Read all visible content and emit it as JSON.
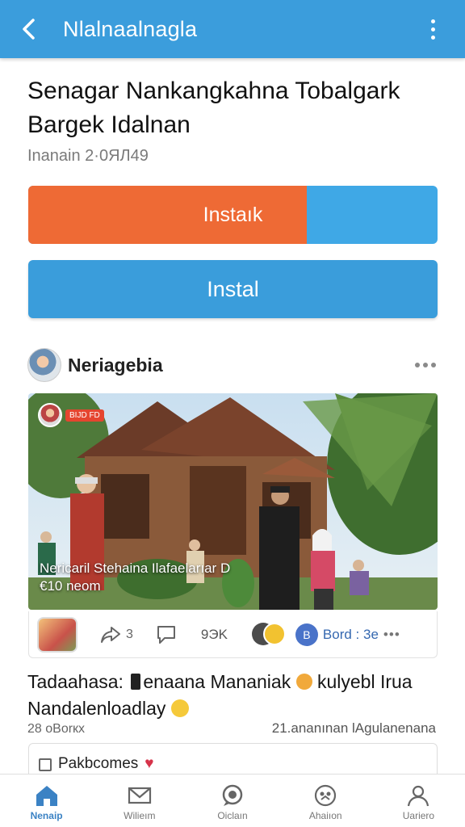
{
  "appbar": {
    "title": "Nlalnaalnagla",
    "back_icon": "back-arrow-icon",
    "menu_icon": "more-vertical-icon"
  },
  "article": {
    "headline": "Senagar Nankangkahna Tobalgark Bargek Idalnan",
    "subline": "Inanain 2·0ЯЛ49"
  },
  "buttons": {
    "progress_label": "Instaık",
    "progress_fraction": 0.68,
    "progress_color": "#ee6a35",
    "track_color": "#3fa8e6",
    "install_label": "Instal"
  },
  "post": {
    "author": "Neriagebia",
    "badge": "BIJD FD",
    "photo_caption": "Nericaril Stehaina Ilafaelarıar D\n€10 neom",
    "actions": {
      "share_count": "3",
      "views_count": "9ЭK",
      "board_label": "Bord : 3e"
    },
    "text_part1": "Tadaahasa: ",
    "text_part2": "enaana Mananiak ",
    "text_part3": "kulyebl Irua Nandalenloadlay ",
    "meta_left": "28 oBorкx",
    "meta_right": "21.ananınan lAgulanenana"
  },
  "mini_card": {
    "label": "Pakbсomes"
  },
  "bottom_nav": [
    {
      "label": "Nenaip",
      "icon": "home-icon",
      "active": true
    },
    {
      "label": "Wilieım",
      "icon": "mail-icon",
      "active": false
    },
    {
      "label": "Oiclaın",
      "icon": "chat-bubble-icon",
      "active": false
    },
    {
      "label": "Ahaiıon",
      "icon": "badge-icon",
      "active": false
    },
    {
      "label": "Uariero",
      "icon": "person-icon",
      "active": false
    }
  ],
  "colors": {
    "brand": "#3b9ddc",
    "accent_orange": "#ee6a35",
    "active_nav": "#3b82c4"
  }
}
